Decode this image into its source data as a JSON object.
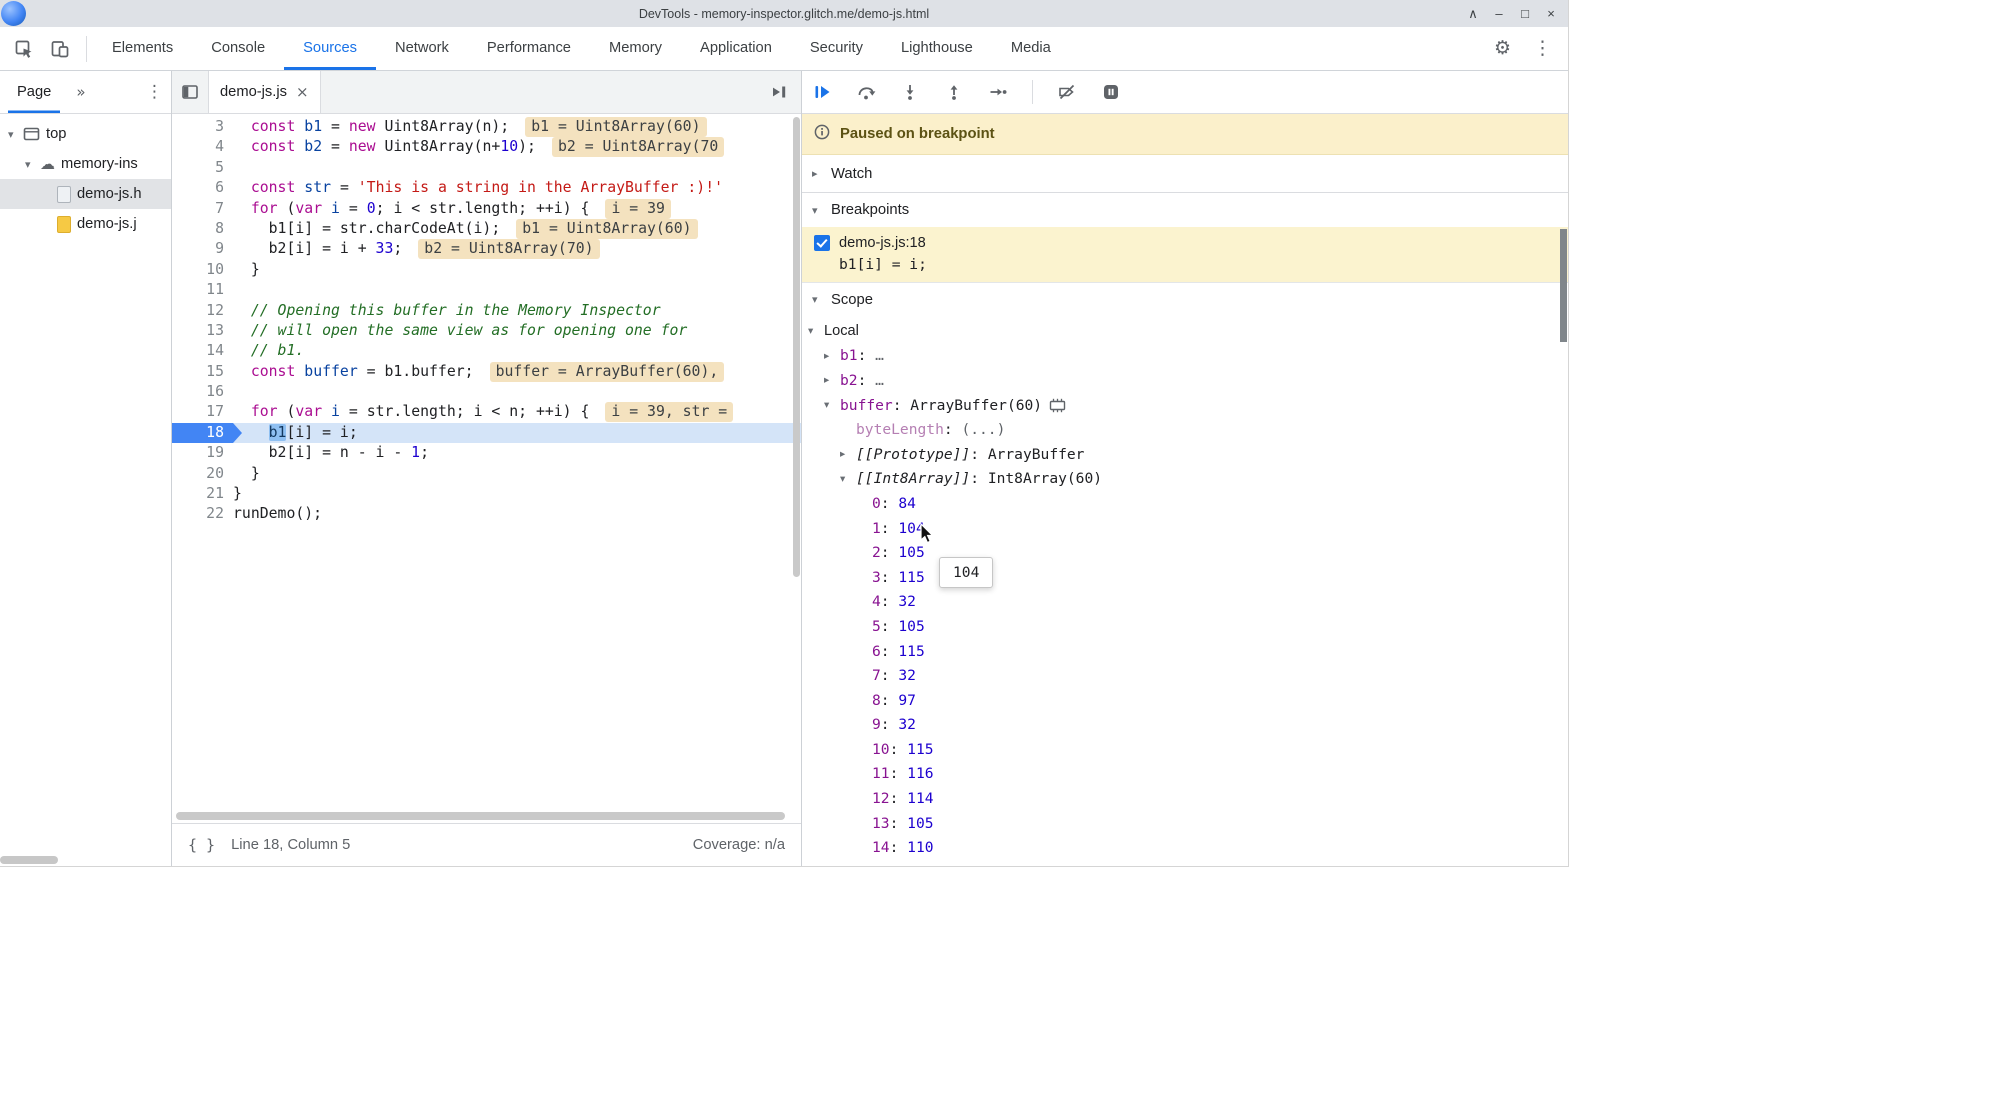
{
  "window": {
    "title": "DevTools - memory-inspector.glitch.me/demo-js.html",
    "controls": [
      "∧",
      "–",
      "□",
      "×"
    ]
  },
  "toolbar": {
    "tabs": [
      {
        "label": "Elements",
        "active": false
      },
      {
        "label": "Console",
        "active": false
      },
      {
        "label": "Sources",
        "active": true
      },
      {
        "label": "Network",
        "active": false
      },
      {
        "label": "Performance",
        "active": false
      },
      {
        "label": "Memory",
        "active": false
      },
      {
        "label": "Application",
        "active": false
      },
      {
        "label": "Security",
        "active": false
      },
      {
        "label": "Lighthouse",
        "active": false
      },
      {
        "label": "Media",
        "active": false
      }
    ],
    "gear": "⚙",
    "menu": "⋮"
  },
  "icons": {
    "inspect": "cursor-in-box",
    "device-toolbar": "overlapping-rectangles",
    "navigator-toggle": "panel-left",
    "debugger-panel-toggle": "play-to-bar",
    "info": "circle-i",
    "memory-inspector": "memory-chip",
    "triangle_collapsed": "▸",
    "triangle_expanded": "▾"
  },
  "sidebar": {
    "header": {
      "tab": "Page",
      "overflow": "»",
      "menu": "⋮"
    },
    "tree": [
      {
        "label": "top",
        "icon": "frame",
        "depth": 0,
        "exp": "down",
        "selected": false
      },
      {
        "label": "memory-ins",
        "icon": "cloud",
        "depth": 1,
        "exp": "down",
        "selected": false
      },
      {
        "label": "demo-js.h",
        "icon": "html",
        "depth": 2,
        "exp": "none",
        "selected": true
      },
      {
        "label": "demo-js.j",
        "icon": "js",
        "depth": 2,
        "exp": "none",
        "selected": false
      }
    ]
  },
  "editor": {
    "tab": {
      "label": "demo-js.js",
      "close": "×"
    },
    "status": {
      "pretty_print": "{ }",
      "position": "Line 18, Column 5",
      "coverage": "Coverage: n/a"
    },
    "code": {
      "lines": [
        {
          "no": 3,
          "tokens": [
            [
              "p",
              "  "
            ],
            [
              "k",
              "const"
            ],
            [
              "p",
              " "
            ],
            [
              "v",
              "b1"
            ],
            [
              "p",
              " = "
            ],
            [
              "k",
              "new"
            ],
            [
              "p",
              " Uint8Array(n);"
            ]
          ],
          "widget": "b1 = Uint8Array(60)"
        },
        {
          "no": 4,
          "tokens": [
            [
              "p",
              "  "
            ],
            [
              "k",
              "const"
            ],
            [
              "p",
              " "
            ],
            [
              "v",
              "b2"
            ],
            [
              "p",
              " = "
            ],
            [
              "k",
              "new"
            ],
            [
              "p",
              " Uint8Array(n+"
            ],
            [
              "n",
              "10"
            ],
            [
              "p",
              ");"
            ]
          ],
          "widget": "b2 = Uint8Array(70"
        },
        {
          "no": 5,
          "tokens": []
        },
        {
          "no": 6,
          "tokens": [
            [
              "p",
              "  "
            ],
            [
              "k",
              "const"
            ],
            [
              "p",
              " "
            ],
            [
              "v",
              "str"
            ],
            [
              "p",
              " = "
            ],
            [
              "s",
              "'This is a string in the ArrayBuffer :)!'"
            ]
          ]
        },
        {
          "no": 7,
          "tokens": [
            [
              "p",
              "  "
            ],
            [
              "k",
              "for"
            ],
            [
              "p",
              " ("
            ],
            [
              "k",
              "var"
            ],
            [
              "p",
              " "
            ],
            [
              "v",
              "i"
            ],
            [
              "p",
              " = "
            ],
            [
              "n",
              "0"
            ],
            [
              "p",
              "; i < str.length; ++i) {"
            ]
          ],
          "widget": "i = 39"
        },
        {
          "no": 8,
          "tokens": [
            [
              "p",
              "    b1[i] = str.charCodeAt(i);"
            ]
          ],
          "widget": "b1 = Uint8Array(60)"
        },
        {
          "no": 9,
          "tokens": [
            [
              "p",
              "    b2[i] = i + "
            ],
            [
              "n",
              "33"
            ],
            [
              "p",
              ";"
            ]
          ],
          "widget": "b2 = Uint8Array(70)"
        },
        {
          "no": 10,
          "tokens": [
            [
              "p",
              "  }"
            ]
          ]
        },
        {
          "no": 11,
          "tokens": []
        },
        {
          "no": 12,
          "tokens": [
            [
              "c",
              "  // Opening this buffer in the Memory Inspector"
            ]
          ]
        },
        {
          "no": 13,
          "tokens": [
            [
              "c",
              "  // will open the same view as for opening one for"
            ]
          ]
        },
        {
          "no": 14,
          "tokens": [
            [
              "c",
              "  // b1."
            ]
          ]
        },
        {
          "no": 15,
          "tokens": [
            [
              "p",
              "  "
            ],
            [
              "k",
              "const"
            ],
            [
              "p",
              " "
            ],
            [
              "v",
              "buffer"
            ],
            [
              "p",
              " = b1.buffer;"
            ]
          ],
          "widget": "buffer = ArrayBuffer(60),"
        },
        {
          "no": 16,
          "tokens": []
        },
        {
          "no": 17,
          "tokens": [
            [
              "p",
              "  "
            ],
            [
              "k",
              "for"
            ],
            [
              "p",
              " ("
            ],
            [
              "k",
              "var"
            ],
            [
              "p",
              " "
            ],
            [
              "v",
              "i"
            ],
            [
              "p",
              " = str.length; i < n; ++i) {"
            ]
          ],
          "widget": "i = 39, str ="
        },
        {
          "no": 18,
          "current": true,
          "tokens": [
            [
              "p",
              "    "
            ],
            [
              "hl",
              "b1"
            ],
            [
              "p",
              "[i] = i;"
            ]
          ]
        },
        {
          "no": 19,
          "tokens": [
            [
              "p",
              "    b2[i] = n - i - "
            ],
            [
              "n",
              "1"
            ],
            [
              "p",
              ";"
            ]
          ]
        },
        {
          "no": 20,
          "tokens": [
            [
              "p",
              "  }"
            ]
          ]
        },
        {
          "no": 21,
          "tokens": [
            [
              "p",
              "}"
            ]
          ]
        },
        {
          "no": 22,
          "tokens": [
            [
              "p",
              "runDemo();"
            ]
          ]
        }
      ]
    }
  },
  "debugger": {
    "toolbar": [
      "resume",
      "step-over",
      "step-into",
      "step-out",
      "step",
      "|",
      "deactivate-breakpoints",
      "pause-on-exceptions"
    ],
    "banner": {
      "text": "Paused on breakpoint"
    },
    "sections": {
      "watch": "Watch",
      "breakpoints": "Breakpoints",
      "scope": "Scope"
    },
    "breakpoint": {
      "checked": true,
      "location": "demo-js.js:18",
      "code": "b1[i] = i;"
    },
    "tooltip": {
      "text": "104"
    },
    "scope": {
      "rows": [
        {
          "depth": 0,
          "exp": "down",
          "name": "Local",
          "nc": "scope"
        },
        {
          "depth": 1,
          "exp": "right",
          "name": "b1",
          "nc": "prop",
          "value": "…",
          "vc": "dim"
        },
        {
          "depth": 1,
          "exp": "right",
          "name": "b2",
          "nc": "prop",
          "value": "…",
          "vc": "dim"
        },
        {
          "depth": 1,
          "exp": "down",
          "name": "buffer",
          "nc": "prop",
          "value": "ArrayBuffer(60)",
          "vc": "plain",
          "icon": "memory"
        },
        {
          "depth": 2,
          "exp": "none",
          "name": "byteLength",
          "nc": "dimprop",
          "value": "(...)",
          "vc": "dim"
        },
        {
          "depth": 2,
          "exp": "right",
          "name": "[[Prototype]]",
          "nc": "internal",
          "value": "ArrayBuffer",
          "vc": "plain"
        },
        {
          "depth": 2,
          "exp": "down",
          "name": "[[Int8Array]]",
          "nc": "internal",
          "value": "Int8Array(60)",
          "vc": "plain"
        },
        {
          "depth": 3,
          "exp": "none",
          "name": "0",
          "nc": "prop",
          "value": "84",
          "vc": "num"
        },
        {
          "depth": 3,
          "exp": "none",
          "name": "1",
          "nc": "prop",
          "value": "104",
          "vc": "num"
        },
        {
          "depth": 3,
          "exp": "none",
          "name": "2",
          "nc": "prop",
          "value": "105",
          "vc": "num"
        },
        {
          "depth": 3,
          "exp": "none",
          "name": "3",
          "nc": "prop",
          "value": "115",
          "vc": "num"
        },
        {
          "depth": 3,
          "exp": "none",
          "name": "4",
          "nc": "prop",
          "value": "32",
          "vc": "num"
        },
        {
          "depth": 3,
          "exp": "none",
          "name": "5",
          "nc": "prop",
          "value": "105",
          "vc": "num"
        },
        {
          "depth": 3,
          "exp": "none",
          "name": "6",
          "nc": "prop",
          "value": "115",
          "vc": "num"
        },
        {
          "depth": 3,
          "exp": "none",
          "name": "7",
          "nc": "prop",
          "value": "32",
          "vc": "num"
        },
        {
          "depth": 3,
          "exp": "none",
          "name": "8",
          "nc": "prop",
          "value": "97",
          "vc": "num"
        },
        {
          "depth": 3,
          "exp": "none",
          "name": "9",
          "nc": "prop",
          "value": "32",
          "vc": "num"
        },
        {
          "depth": 3,
          "exp": "none",
          "name": "10",
          "nc": "prop",
          "value": "115",
          "vc": "num"
        },
        {
          "depth": 3,
          "exp": "none",
          "name": "11",
          "nc": "prop",
          "value": "116",
          "vc": "num"
        },
        {
          "depth": 3,
          "exp": "none",
          "name": "12",
          "nc": "prop",
          "value": "114",
          "vc": "num"
        },
        {
          "depth": 3,
          "exp": "none",
          "name": "13",
          "nc": "prop",
          "value": "105",
          "vc": "num"
        },
        {
          "depth": 3,
          "exp": "none",
          "name": "14",
          "nc": "prop",
          "value": "110",
          "vc": "num"
        }
      ]
    }
  },
  "colors": {
    "accent": "#1a73e8",
    "paused_banner_bg": "#fbf0cb",
    "inline_hint_bg": "#f4e2bf",
    "current_line_bg": "#d4e4f8",
    "breakpoint_item_bg": "#fbf3cf",
    "keyword": "#aa0d91",
    "string": "#c41a16",
    "number": "#1c00cf",
    "comment": "#236e25",
    "definition": "#0842a0",
    "property": "#881391"
  }
}
